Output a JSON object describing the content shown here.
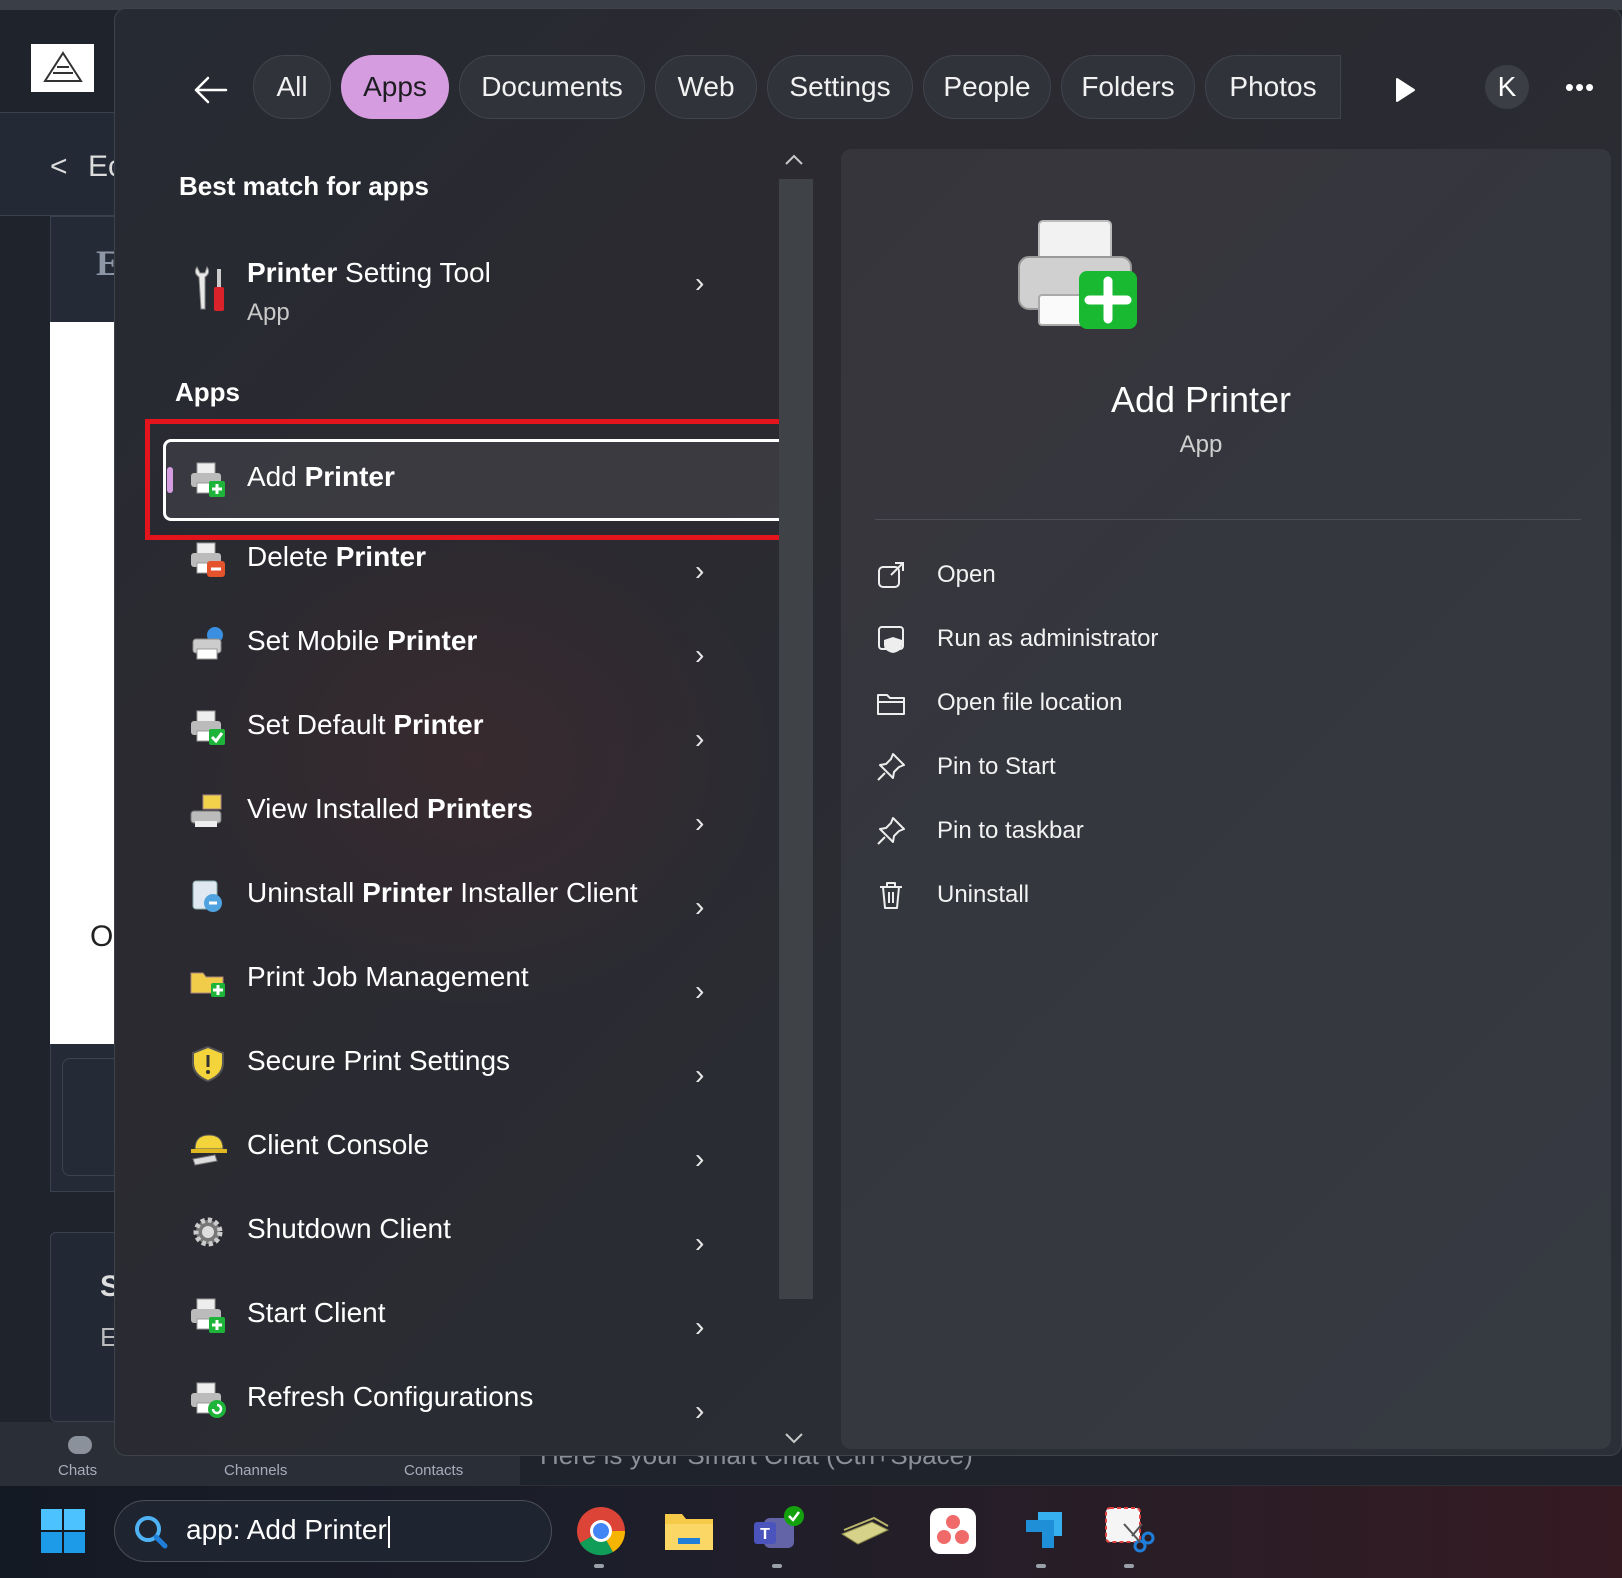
{
  "background_app": {
    "back_label": "<",
    "title_partial": "Ec",
    "card_heading_partial": "E",
    "text_o": "O",
    "card2_s": "S",
    "card2_e": "E",
    "nav": [
      "Chats",
      "Channels",
      "Contacts"
    ],
    "chat_text": "Here is your Smart Chat (Ctrl+Space)"
  },
  "filters": {
    "chips": [
      "All",
      "Apps",
      "Documents",
      "Web",
      "Settings",
      "People",
      "Folders",
      "Photos"
    ],
    "active": "Apps",
    "avatar_initial": "K",
    "more_label": "•••"
  },
  "best_match": {
    "heading": "Best match for apps",
    "name_bold": "Printer",
    "name_rest": " Setting Tool",
    "type": "App"
  },
  "apps": {
    "heading": "Apps",
    "items": [
      {
        "pre": "Add ",
        "bold": "Printer",
        "post": "",
        "icon": "printer-add-icon",
        "selected": true
      },
      {
        "pre": "Delete ",
        "bold": "Printer",
        "post": "",
        "icon": "printer-delete-icon"
      },
      {
        "pre": "Set Mobile ",
        "bold": "Printer",
        "post": "",
        "icon": "mobile-printer-icon"
      },
      {
        "pre": "Set Default ",
        "bold": "Printer",
        "post": "",
        "icon": "printer-default-icon"
      },
      {
        "pre": "View Installed ",
        "bold": "Printers",
        "post": "",
        "icon": "installed-printers-icon"
      },
      {
        "pre": "Uninstall ",
        "bold": "Printer",
        "post": " Installer Client",
        "icon": "uninstall-client-icon"
      },
      {
        "pre": "Print Job Management",
        "bold": "",
        "post": "",
        "icon": "print-job-icon"
      },
      {
        "pre": "Secure Print Settings",
        "bold": "",
        "post": "",
        "icon": "shield-icon"
      },
      {
        "pre": "Client Console",
        "bold": "",
        "post": "",
        "icon": "hard-hat-icon"
      },
      {
        "pre": "Shutdown Client",
        "bold": "",
        "post": "",
        "icon": "gear-icon"
      },
      {
        "pre": "Start Client",
        "bold": "",
        "post": "",
        "icon": "printer-start-icon"
      },
      {
        "pre": "Refresh Configurations",
        "bold": "",
        "post": "",
        "icon": "printer-refresh-icon"
      }
    ]
  },
  "preview": {
    "title": "Add Printer",
    "type": "App",
    "actions": [
      {
        "label": "Open",
        "icon": "open-external-icon"
      },
      {
        "label": "Run as administrator",
        "icon": "shield-admin-icon"
      },
      {
        "label": "Open file location",
        "icon": "folder-icon"
      },
      {
        "label": "Pin to Start",
        "icon": "pin-icon"
      },
      {
        "label": "Pin to taskbar",
        "icon": "pin-icon"
      },
      {
        "label": "Uninstall",
        "icon": "trash-icon"
      }
    ]
  },
  "taskbar": {
    "search_text": "app: Add Printer",
    "apps": [
      "chrome-icon",
      "file-explorer-icon",
      "teams-icon",
      "money-icon",
      "asana-icon",
      "app-icon",
      "snipping-tool-icon"
    ]
  },
  "colors": {
    "accent": "#d59ce0",
    "highlight_box": "#e3141b",
    "panel_bg": "#2a2c33"
  }
}
